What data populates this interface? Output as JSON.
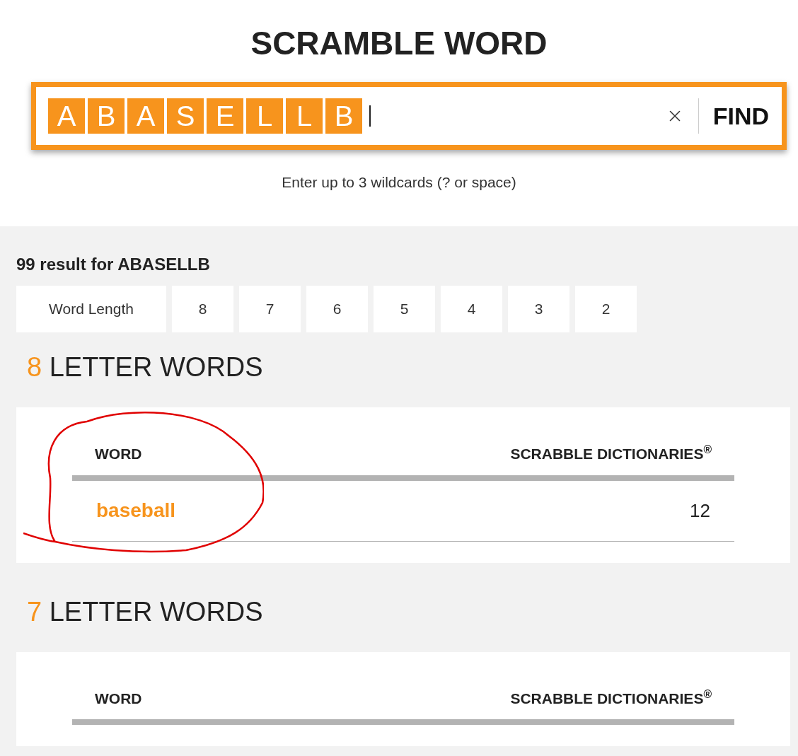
{
  "title": "SCRAMBLE WORD",
  "search": {
    "tiles": [
      "A",
      "B",
      "A",
      "S",
      "E",
      "L",
      "L",
      "B"
    ],
    "button": "FIND"
  },
  "hint": "Enter up to 3 wildcards (? or space)",
  "results_heading": "99 result for ABASELLB",
  "length_filter": {
    "label": "Word Length",
    "options": [
      "8",
      "7",
      "6",
      "5",
      "4",
      "3",
      "2"
    ]
  },
  "sections": [
    {
      "count": "8",
      "title": "LETTER WORDS",
      "columns": [
        "WORD",
        "SCRABBLE DICTIONARIES$^{®}$"
      ],
      "rows": [
        {
          "word": "baseball",
          "score": "12"
        }
      ]
    },
    {
      "count": "7",
      "title": "LETTER WORDS",
      "columns": [
        "WORD",
        "SCRABBLE DICTIONARIES$^{®}$"
      ]
    }
  ]
}
